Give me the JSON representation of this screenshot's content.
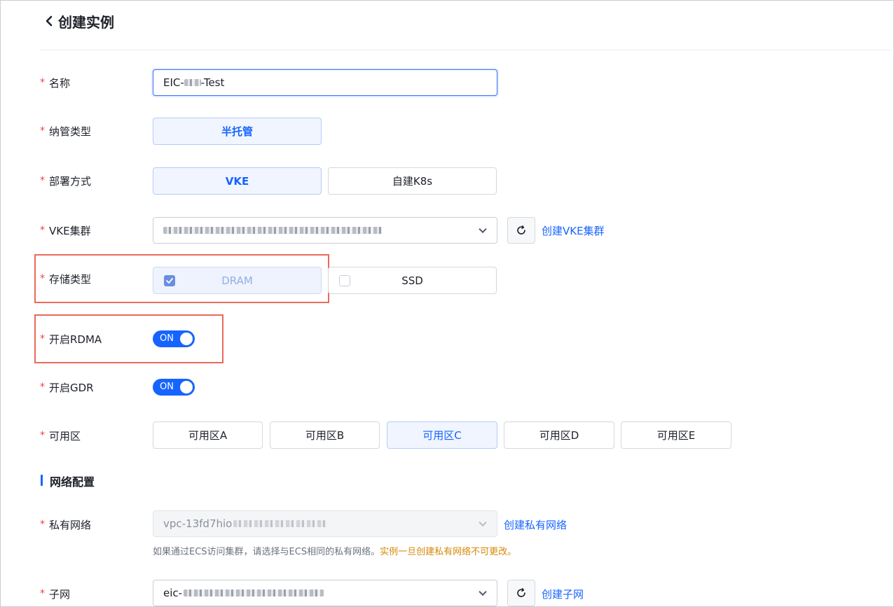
{
  "header": {
    "title": "创建实例"
  },
  "form": {
    "name": {
      "label": "名称",
      "value_prefix": "EIC-",
      "value_suffix": "-Test"
    },
    "managed_type": {
      "label": "纳管类型",
      "options": [
        "半托管"
      ],
      "selected": "半托管"
    },
    "deploy_mode": {
      "label": "部署方式",
      "options": [
        "VKE",
        "自建K8s"
      ],
      "selected": "VKE"
    },
    "vke_cluster": {
      "label": "VKE集群",
      "create_link": "创建VKE集群"
    },
    "storage_type": {
      "label": "存储类型",
      "options": [
        "DRAM",
        "SSD"
      ],
      "checked": "DRAM"
    },
    "rdma": {
      "label": "开启RDMA",
      "state": "ON"
    },
    "gdr": {
      "label": "开启GDR",
      "state": "ON"
    },
    "zone": {
      "label": "可用区",
      "options": [
        "可用区A",
        "可用区B",
        "可用区C",
        "可用区D",
        "可用区E"
      ],
      "selected": "可用区C"
    }
  },
  "network": {
    "section_title": "网络配置",
    "vpc": {
      "label": "私有网络",
      "value_prefix": "vpc-13fd7hio",
      "create_link": "创建私有网络",
      "help": "如果通过ECS访问集群，请选择与ECS相同的私有网络。",
      "warning": "实例一旦创建私有网络不可更改。"
    },
    "subnet": {
      "label": "子网",
      "value_prefix": "eic-",
      "create_link": "创建子网"
    }
  },
  "colors": {
    "accent": "#1664ff",
    "required": "#f53f3f",
    "highlight": "#ea6a5a",
    "warning": "#d48806"
  }
}
